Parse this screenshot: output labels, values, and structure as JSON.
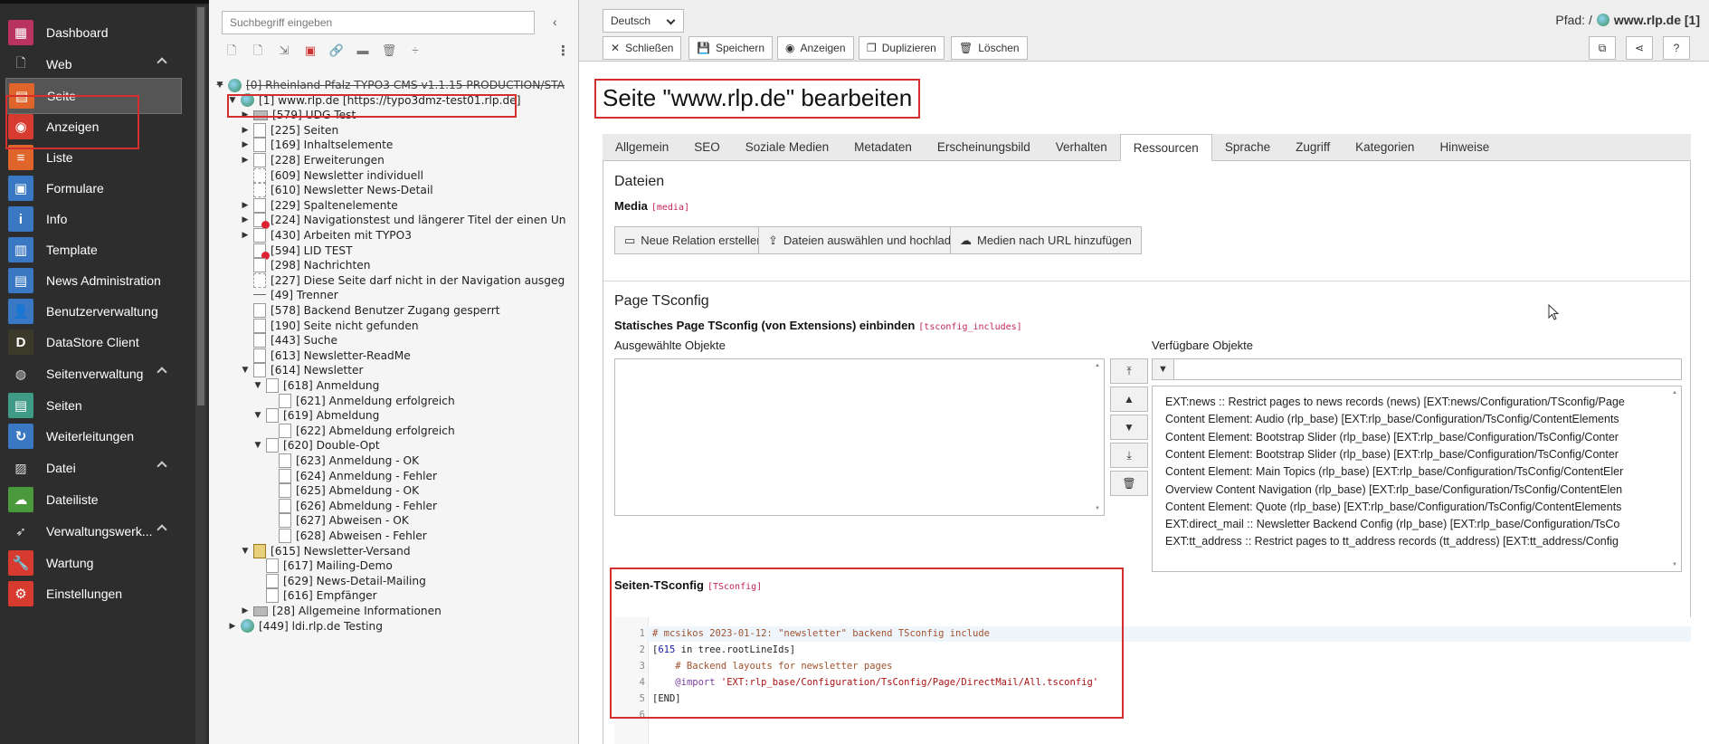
{
  "sidebar": {
    "items": [
      {
        "name": "dashboard",
        "label": "Dashboard",
        "icon": "dashboard-icon",
        "color": "#b8335f",
        "glyph": "▦",
        "top": 0,
        "type": "item"
      },
      {
        "name": "web",
        "label": "Web",
        "icon": "file-icon",
        "glyph": "🗋",
        "type": "group"
      },
      {
        "name": "seite",
        "label": "Seite",
        "icon": "page-icon",
        "color": "#e0652b",
        "glyph": "▤",
        "type": "item",
        "active": true
      },
      {
        "name": "anzeigen",
        "label": "Anzeigen",
        "icon": "eye-icon",
        "color": "#d73b2f",
        "glyph": "◉",
        "type": "item"
      },
      {
        "name": "liste",
        "label": "Liste",
        "icon": "list-icon",
        "color": "#e0652b",
        "glyph": "≡",
        "type": "item"
      },
      {
        "name": "formulare",
        "label": "Formulare",
        "icon": "form-icon",
        "color": "#3a78c3",
        "glyph": "▣",
        "type": "item"
      },
      {
        "name": "info",
        "label": "Info",
        "icon": "info-icon",
        "color": "#3a78c3",
        "glyph": "i",
        "type": "item"
      },
      {
        "name": "template",
        "label": "Template",
        "icon": "template-icon",
        "color": "#3a78c3",
        "glyph": "▥",
        "type": "item"
      },
      {
        "name": "news-administration",
        "label": "News Administration",
        "icon": "news-icon",
        "color": "#3a78c3",
        "glyph": "▤",
        "type": "item"
      },
      {
        "name": "benutzerverwaltung",
        "label": "Benutzerverwaltung",
        "icon": "user-icon",
        "color": "#3a78c3",
        "glyph": "👤",
        "type": "item"
      },
      {
        "name": "datastore-client",
        "label": "DataStore Client",
        "icon": "datastore-icon",
        "color": "#3b3a2a",
        "glyph": "D",
        "type": "item"
      },
      {
        "name": "seitenverwaltung",
        "label": "Seitenverwaltung",
        "icon": "globe-icon",
        "glyph": "◍",
        "type": "group"
      },
      {
        "name": "seiten",
        "label": "Seiten",
        "icon": "pages-icon",
        "color": "#3f9a86",
        "glyph": "▤",
        "type": "item"
      },
      {
        "name": "weiterleitungen",
        "label": "Weiterleitungen",
        "icon": "redirect-icon",
        "color": "#3a78c3",
        "glyph": "↻",
        "type": "item"
      },
      {
        "name": "datei",
        "label": "Datei",
        "icon": "image-icon",
        "glyph": "▨",
        "type": "group"
      },
      {
        "name": "dateiliste",
        "label": "Dateiliste",
        "icon": "filelist-icon",
        "color": "#4a9a3d",
        "glyph": "☁",
        "type": "item"
      },
      {
        "name": "verwaltungswerkzeuge",
        "label": "Verwaltungswerk...",
        "icon": "rocket-icon",
        "glyph": "➶",
        "type": "group"
      },
      {
        "name": "wartung",
        "label": "Wartung",
        "icon": "wrench-icon",
        "color": "#d73b2f",
        "glyph": "🔧",
        "type": "item"
      },
      {
        "name": "einstellungen",
        "label": "Einstellungen",
        "icon": "settings-icon",
        "color": "#d73b2f",
        "glyph": "⚙",
        "type": "item"
      }
    ]
  },
  "tree": {
    "search_placeholder": "Suchbegriff eingeben",
    "nodes": [
      {
        "label": "[0] Rheinland-Pfalz TYPO3 CMS v1.1.15 PRODUCTION/STA",
        "level": 0,
        "toggle": "▼",
        "icon": "root",
        "strike": true
      },
      {
        "label": "[1] www.rlp.de [https://typo3dmz-test01.rlp.de]",
        "level": 1,
        "toggle": "▼",
        "icon": "globe"
      },
      {
        "label": "[579] UDG Test",
        "level": 2,
        "toggle": "▶",
        "icon": "folder"
      },
      {
        "label": "[225] Seiten",
        "level": 2,
        "toggle": "▶",
        "icon": "page"
      },
      {
        "label": "[169] Inhaltselemente",
        "level": 2,
        "toggle": "▶",
        "icon": "page"
      },
      {
        "label": "[228] Erweiterungen",
        "level": 2,
        "toggle": "▶",
        "icon": "page"
      },
      {
        "label": "[609] Newsletter individuell",
        "level": 2,
        "toggle": "",
        "icon": "hidden"
      },
      {
        "label": "[610] Newsletter News-Detail",
        "level": 2,
        "toggle": "",
        "icon": "hidden"
      },
      {
        "label": "[229] Spaltenelemente",
        "level": 2,
        "toggle": "▶",
        "icon": "page"
      },
      {
        "label": "[224] Navigationstest und längerer Titel der einen Un",
        "level": 2,
        "toggle": "▶",
        "icon": "red"
      },
      {
        "label": "[430] Arbeiten mit TYPO3",
        "level": 2,
        "toggle": "▶",
        "icon": "page"
      },
      {
        "label": "[594] LID TEST",
        "level": 2,
        "toggle": "",
        "icon": "red"
      },
      {
        "label": "[298] Nachrichten",
        "level": 2,
        "toggle": "",
        "icon": "page"
      },
      {
        "label": "[227] Diese Seite darf nicht in der Navigation ausgeg",
        "level": 2,
        "toggle": "",
        "icon": "hidden"
      },
      {
        "label": "[49] Trenner",
        "level": 2,
        "toggle": "",
        "icon": "sep"
      },
      {
        "label": "[578] Backend Benutzer Zugang gesperrt",
        "level": 2,
        "toggle": "",
        "icon": "page"
      },
      {
        "label": "[190] Seite nicht gefunden",
        "level": 2,
        "toggle": "",
        "icon": "page"
      },
      {
        "label": "[443] Suche",
        "level": 2,
        "toggle": "",
        "icon": "page"
      },
      {
        "label": "[613] Newsletter-ReadMe",
        "level": 2,
        "toggle": "",
        "icon": "page"
      },
      {
        "label": "[614] Newsletter",
        "level": 2,
        "toggle": "▼",
        "icon": "page"
      },
      {
        "label": "[618] Anmeldung",
        "level": 3,
        "toggle": "▼",
        "icon": "page"
      },
      {
        "label": "[621] Anmeldung erfolgreich",
        "level": 4,
        "toggle": "",
        "icon": "page"
      },
      {
        "label": "[619] Abmeldung",
        "level": 3,
        "toggle": "▼",
        "icon": "page"
      },
      {
        "label": "[622] Abmeldung erfolgreich",
        "level": 4,
        "toggle": "",
        "icon": "page"
      },
      {
        "label": "[620] Double-Opt",
        "level": 3,
        "toggle": "▼",
        "icon": "page"
      },
      {
        "label": "[623] Anmeldung - OK",
        "level": 4,
        "toggle": "",
        "icon": "page"
      },
      {
        "label": "[624] Anmeldung - Fehler",
        "level": 4,
        "toggle": "",
        "icon": "page"
      },
      {
        "label": "[625] Abmeldung - OK",
        "level": 4,
        "toggle": "",
        "icon": "page"
      },
      {
        "label": "[626] Abmeldung - Fehler",
        "level": 4,
        "toggle": "",
        "icon": "page"
      },
      {
        "label": "[627] Abweisen - OK",
        "level": 4,
        "toggle": "",
        "icon": "page"
      },
      {
        "label": "[628] Abweisen - Fehler",
        "level": 4,
        "toggle": "",
        "icon": "page"
      },
      {
        "label": "[615] Newsletter-Versand",
        "level": 2,
        "toggle": "▼",
        "icon": "mail"
      },
      {
        "label": "[617] Mailing-Demo",
        "level": 3,
        "toggle": "",
        "icon": "page"
      },
      {
        "label": "[629] News-Detail-Mailing",
        "level": 3,
        "toggle": "",
        "icon": "page"
      },
      {
        "label": "[616] Empfänger",
        "level": 3,
        "toggle": "",
        "icon": "page"
      },
      {
        "label": "[28] Allgemeine Informationen",
        "level": 2,
        "toggle": "▶",
        "icon": "folder"
      },
      {
        "label": "[449] ldi.rlp.de Testing",
        "level": 1,
        "toggle": "▶",
        "icon": "globe"
      }
    ]
  },
  "header": {
    "language": "Deutsch",
    "buttons": {
      "close": "Schließen",
      "save": "Speichern",
      "view": "Anzeigen",
      "duplicate": "Duplizieren",
      "delete": "Löschen"
    },
    "path_label": "Pfad: /",
    "path_title": "www.rlp.de [1]",
    "help": "?"
  },
  "page_title": "Seite \"www.rlp.de\" bearbeiten",
  "tabs": [
    "Allgemein",
    "SEO",
    "Soziale Medien",
    "Metadaten",
    "Erscheinungsbild",
    "Verhalten",
    "Ressourcen",
    "Sprache",
    "Zugriff",
    "Kategorien",
    "Hinweise"
  ],
  "active_tab": "Ressourcen",
  "files": {
    "section_title": "Dateien",
    "media_label": "Media",
    "media_key": "[media]",
    "new_relation": "Neue Relation erstellen",
    "upload": "Dateien auswählen und hochladen",
    "url_media": "Medien nach URL hinzufügen"
  },
  "tsconfig": {
    "section_title": "Page TSconfig",
    "static_label": "Statisches Page TSconfig (von Extensions) einbinden",
    "static_key": "[tsconfig_includes]",
    "selected_label": "Ausgewählte Objekte",
    "available_label": "Verfügbare Objekte",
    "available_items": [
      "EXT:news :: Restrict pages to news records (news) [EXT:news/Configuration/TSconfig/Page",
      "Content Element: Audio (rlp_base) [EXT:rlp_base/Configuration/TsConfig/ContentElements",
      "Content Element: Bootstrap Slider (rlp_base) [EXT:rlp_base/Configuration/TsConfig/Conter",
      "Content Element: Bootstrap Slider (rlp_base) [EXT:rlp_base/Configuration/TsConfig/Conter",
      "Content Element: Main Topics (rlp_base) [EXT:rlp_base/Configuration/TsConfig/ContentEler",
      "Overview Content Navigation (rlp_base) [EXT:rlp_base/Configuration/TsConfig/ContentElen",
      "Content Element: Quote (rlp_base) [EXT:rlp_base/Configuration/TsConfig/ContentElements",
      "EXT:direct_mail :: Newsletter Backend Config (rlp_base) [EXT:rlp_base/Configuration/TsCo",
      "EXT:tt_address :: Restrict pages to tt_address records (tt_address) [EXT:tt_address/Config"
    ],
    "page_ts_label": "Seiten-TSconfig",
    "page_ts_key": "[TSconfig]",
    "code": {
      "line_numbers": [
        "1",
        "2",
        "3",
        "4",
        "5",
        "6"
      ],
      "l1": "# mcsikos 2023-01-12: \"newsletter\" backend TSconfig include",
      "l2_open": "[",
      "l2_num": "615",
      "l2_rest": " in tree.rootLineIds]",
      "l3": "    # Backend layouts for newsletter pages",
      "l4_indent": "    ",
      "l4_kw": "@import",
      "l4_str": " 'EXT:rlp_base/Configuration/TsConfig/Page/DirectMail/All.tsconfig'",
      "l5": "[END]"
    }
  }
}
